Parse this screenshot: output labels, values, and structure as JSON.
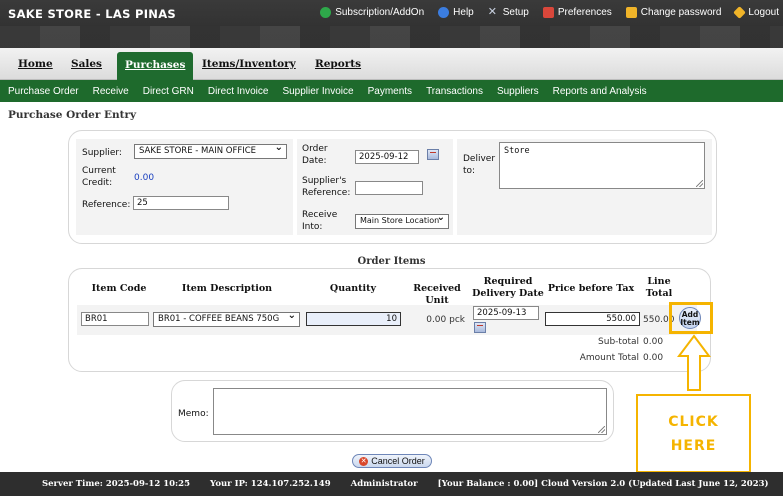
{
  "header": {
    "store_title": "SAKE STORE - LAS PINAS",
    "links": [
      {
        "label": "Subscription/AddOn",
        "icon": "globe-icon",
        "color": "#2ea84a"
      },
      {
        "label": "Help",
        "icon": "help-icon",
        "color": "#3b7de0"
      },
      {
        "label": "Setup",
        "icon": "wrench-icon",
        "color": "#9aa3b5"
      },
      {
        "label": "Preferences",
        "icon": "preferences-icon",
        "color": "#d9473b"
      },
      {
        "label": "Change password",
        "icon": "lock-icon",
        "color": "#f0b429"
      },
      {
        "label": "Logout",
        "icon": "key-icon",
        "color": "#f0b429"
      }
    ]
  },
  "mainnav": [
    "Home",
    "Sales",
    "Purchases",
    "Items/Inventory",
    "Reports"
  ],
  "subnav": [
    "Purchase Order",
    "Receive",
    "Direct GRN",
    "Direct Invoice",
    "Supplier Invoice",
    "Payments",
    "Transactions",
    "Suppliers",
    "Reports and Analysis"
  ],
  "page_title": "Purchase Order Entry",
  "form": {
    "supplier_label": "Supplier:",
    "supplier_value": "SAKE STORE - MAIN OFFICE",
    "current_credit_label": "Current Credit:",
    "current_credit_value": "0.00",
    "reference_label": "Reference:",
    "reference_value": "25",
    "order_date_label": "Order Date:",
    "order_date_value": "2025-09-12",
    "supplier_reference_label": "Supplier's Reference:",
    "supplier_reference_value": "",
    "receive_into_label": "Receive Into:",
    "receive_into_value": "Main Store Location",
    "deliver_to_label": "Deliver to:",
    "deliver_to_value": "Store"
  },
  "items": {
    "title": "Order Items",
    "headers": {
      "item_code": "Item Code",
      "item_description": "Item Description",
      "quantity": "Quantity",
      "received_unit": "Received Unit",
      "required_delivery_date": "Required Delivery Date",
      "price_before_tax": "Price before Tax",
      "line_total": "Line Total"
    },
    "row": {
      "item_code": "BR01",
      "item_description": "BR01 - COFFEE BEANS 750G",
      "quantity": "10",
      "received_unit": "0.00 pck",
      "required_delivery_date": "2025-09-13",
      "price_before_tax": "550.00",
      "line_total": "550.00",
      "add_item_label": "Add Item"
    },
    "subtotal_label": "Sub-total",
    "subtotal_value": "0.00",
    "amount_total_label": "Amount Total",
    "amount_total_value": "0.00"
  },
  "memo_label": "Memo:",
  "memo_value": "",
  "callout": {
    "line1": "CLICK",
    "line2": "HERE",
    "color": "#f5b400"
  },
  "cancel_label": "Cancel Order",
  "footer": {
    "server_time": "Server Time: 2025-09-12 10:25",
    "ip": "Your IP: 124.107.252.149",
    "user": "Administrator",
    "balance": "[Your Balance : 0.00] Cloud Version 2.0 (Updated Last June 12, 2023)"
  }
}
